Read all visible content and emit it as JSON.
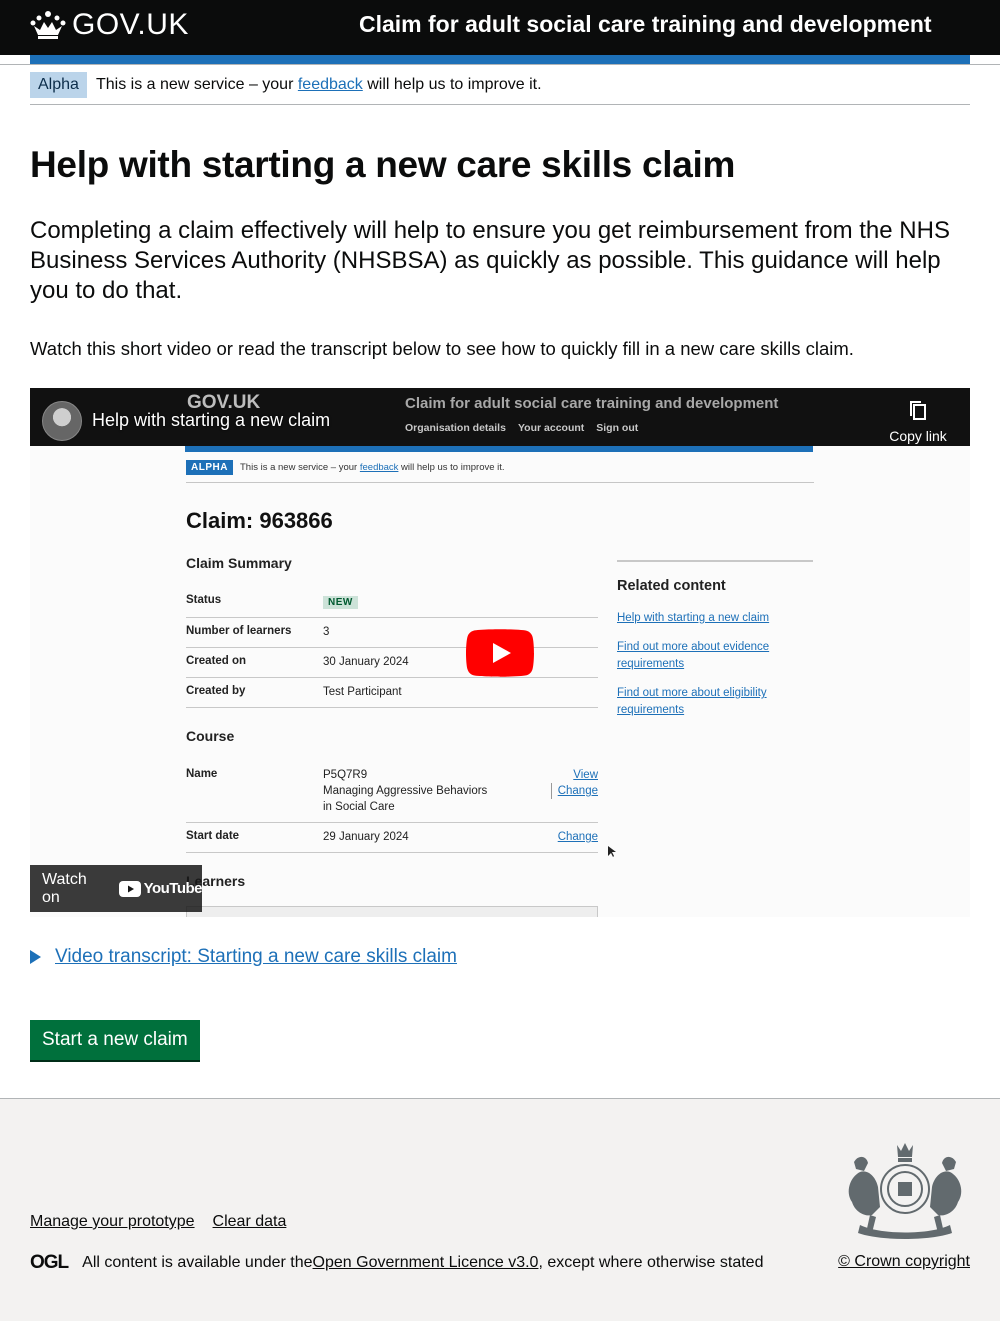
{
  "header": {
    "logo_text": "GOV.UK",
    "service_name": "Claim for adult social care training and development"
  },
  "phase_banner": {
    "tag": "Alpha",
    "text_before": "This is a new service – your ",
    "link": "feedback",
    "text_after": " will help us to improve it."
  },
  "page": {
    "title": "Help with starting a new care skills claim",
    "lead": "Completing a claim effectively will help to ensure you get reimbursement from the NHS Business Services Authority (NHSBSA) as quickly as possible. This guidance will help you to do that.",
    "body": "Watch this short video or read the transcript below to see how to quickly fill in a new care skills claim."
  },
  "video": {
    "title": "Help with starting a new claim",
    "copy_link": "Copy link",
    "watch_on": "Watch on",
    "youtube": "YouTube",
    "frame": {
      "logo": "GOV.UK",
      "service": "Claim for adult social care training and development",
      "nav": [
        "Organisation details",
        "Your account",
        "Sign out"
      ],
      "alpha_tag": "ALPHA",
      "alpha_before": "This is a new service – your ",
      "alpha_link": "feedback",
      "alpha_after": " will help us to improve it.",
      "claim_heading": "Claim: 963866",
      "summary_heading": "Claim Summary",
      "summary": [
        {
          "key": "Status",
          "value": "NEW"
        },
        {
          "key": "Number of learners",
          "value": "3"
        },
        {
          "key": "Created on",
          "value": "30 January 2024"
        },
        {
          "key": "Created by",
          "value": "Test Participant"
        }
      ],
      "course_heading": "Course",
      "course_name_key": "Name",
      "course_name_value": [
        "P5Q7R9",
        "Managing Aggressive Behaviors",
        "in Social Care"
      ],
      "course_actions": [
        "View",
        "Change"
      ],
      "start_date_key": "Start date",
      "start_date_value": "29 January 2024",
      "start_date_action": "Change",
      "learners_heading": "Learners",
      "related_heading": "Related content",
      "related_links": [
        "Help with starting a new claim",
        "Find out more about evidence requirements",
        "Find out more about eligibility requirements"
      ]
    }
  },
  "details_summary": "Video transcript: Starting a new care skills claim",
  "start_button": "Start a new claim",
  "footer": {
    "links": [
      "Manage your prototype",
      "Clear data"
    ],
    "ogl_logo": "OGL",
    "licence_before": "All content is available under the ",
    "licence_link": "Open Government Licence v3.0",
    "licence_after": ", except where otherwise stated",
    "copyright": "© Crown copyright"
  },
  "colors": {
    "header_bg": "#0b0c0c",
    "brand_blue": "#1d70b8",
    "button_green": "#00703c",
    "footer_bg": "#f3f2f1",
    "phase_tag_bg": "#bbd4ea"
  }
}
